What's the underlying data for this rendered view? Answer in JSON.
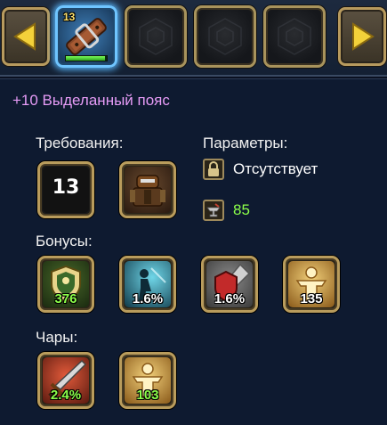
{
  "slot_bar": {
    "active_item_level": "13",
    "active_item_bar_fraction": 0.95
  },
  "item": {
    "name": "+10 Выделанный пояс"
  },
  "requirements": {
    "label": "Требования:",
    "level": "13"
  },
  "parameters": {
    "label": "Параметры:",
    "binding_text": "Отсутствует",
    "durability_value": "85"
  },
  "bonuses": {
    "label": "Бонусы:",
    "items": [
      {
        "value": "376",
        "icon": "defense-shield-icon"
      },
      {
        "value": "1.6%",
        "icon": "evasion-figure-icon"
      },
      {
        "value": "1.6%",
        "icon": "block-shield-sword-icon"
      },
      {
        "value": "135",
        "icon": "health-figure-icon"
      }
    ]
  },
  "enchants": {
    "label": "Чары:",
    "items": [
      {
        "value": "2.4%",
        "icon": "attack-sword-icon"
      },
      {
        "value": "103",
        "icon": "health-figure-icon"
      }
    ]
  },
  "colors": {
    "item_name": "#e79cf7",
    "positive_value": "#8cff4a",
    "frame_gold": "#b99c5c",
    "active_slot_glow": "#59b8ff"
  }
}
